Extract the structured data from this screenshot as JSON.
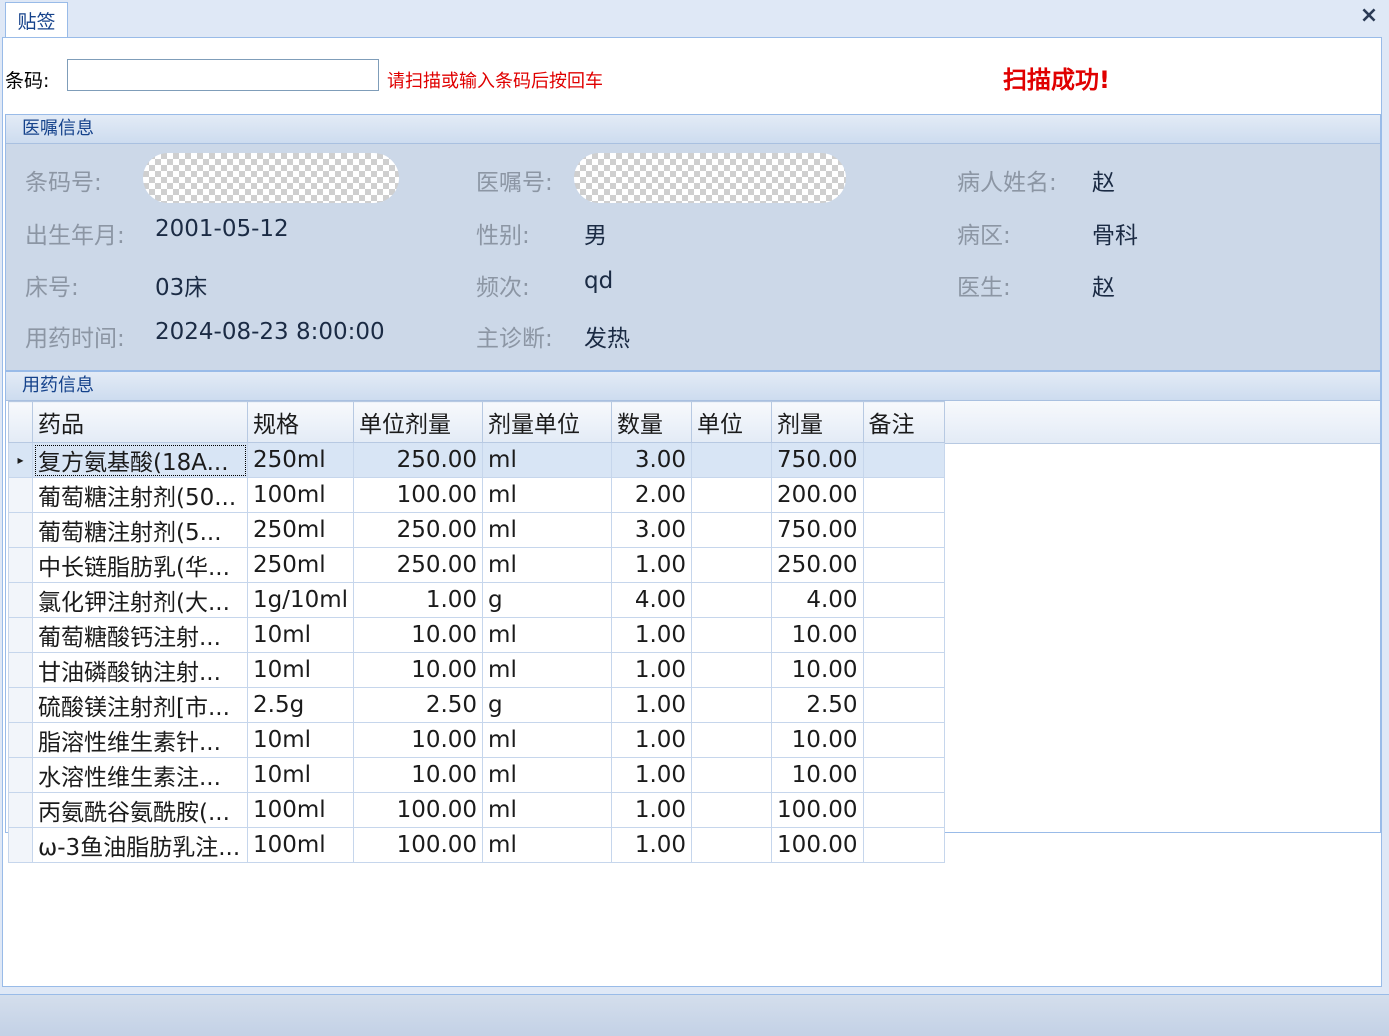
{
  "tab": {
    "label": "贴签"
  },
  "window": {
    "close_glyph": "×"
  },
  "scan": {
    "label": "条码:",
    "input_value": "",
    "hint": "请扫描或输入条码后按回车",
    "status": "扫描成功!"
  },
  "order_info": {
    "title": "医嘱信息",
    "barcode_label": "条码号:",
    "order_no_label": "医嘱号:",
    "patient_name_label": "病人姓名:",
    "patient_name": "赵",
    "birth_label": "出生年月:",
    "birth": "2001-05-12",
    "gender_label": "性别:",
    "gender": "男",
    "ward_label": "病区:",
    "ward": "骨科",
    "bed_label": "床号:",
    "bed": "03床",
    "freq_label": "频次:",
    "freq": "qd",
    "doctor_label": "医生:",
    "doctor": "赵",
    "time_label": "用药时间:",
    "time": "2024-08-23 8:00:00",
    "diagnosis_label": "主诊断:",
    "diagnosis": "发热"
  },
  "drug_info": {
    "title": "用药信息",
    "columns": [
      "药品",
      "规格",
      "单位剂量",
      "剂量单位",
      "数量",
      "单位",
      "剂量",
      "备注"
    ],
    "selected_marker": "▸",
    "rows": [
      [
        "复方氨基酸(18A...",
        "250ml",
        "250.00",
        "ml",
        "3.00",
        "",
        "750.00",
        ""
      ],
      [
        "葡萄糖注射剂(50...",
        "100ml",
        "100.00",
        "ml",
        "2.00",
        "",
        "200.00",
        ""
      ],
      [
        "葡萄糖注射剂(5...",
        "250ml",
        "250.00",
        "ml",
        "3.00",
        "",
        "750.00",
        ""
      ],
      [
        "中长链脂肪乳(华...",
        "250ml",
        "250.00",
        "ml",
        "1.00",
        "",
        "250.00",
        ""
      ],
      [
        "氯化钾注射剂(大...",
        "1g/10ml",
        "1.00",
        "g",
        "4.00",
        "",
        "4.00",
        ""
      ],
      [
        "葡萄糖酸钙注射...",
        "10ml",
        "10.00",
        "ml",
        "1.00",
        "",
        "10.00",
        ""
      ],
      [
        "甘油磷酸钠注射...",
        "10ml",
        "10.00",
        "ml",
        "1.00",
        "",
        "10.00",
        ""
      ],
      [
        "硫酸镁注射剂[市...",
        "2.5g",
        "2.50",
        "g",
        "1.00",
        "",
        "2.50",
        ""
      ],
      [
        "脂溶性维生素针...",
        "10ml",
        "10.00",
        "ml",
        "1.00",
        "",
        "10.00",
        ""
      ],
      [
        "水溶性维生素注...",
        "10ml",
        "10.00",
        "ml",
        "1.00",
        "",
        "10.00",
        ""
      ],
      [
        "丙氨酰谷氨酰胺(...",
        "100ml",
        "100.00",
        "ml",
        "1.00",
        "",
        "100.00",
        ""
      ],
      [
        "ω-3鱼油脂肪乳注...",
        "100ml",
        "100.00",
        "ml",
        "1.00",
        "",
        "100.00",
        ""
      ]
    ]
  }
}
